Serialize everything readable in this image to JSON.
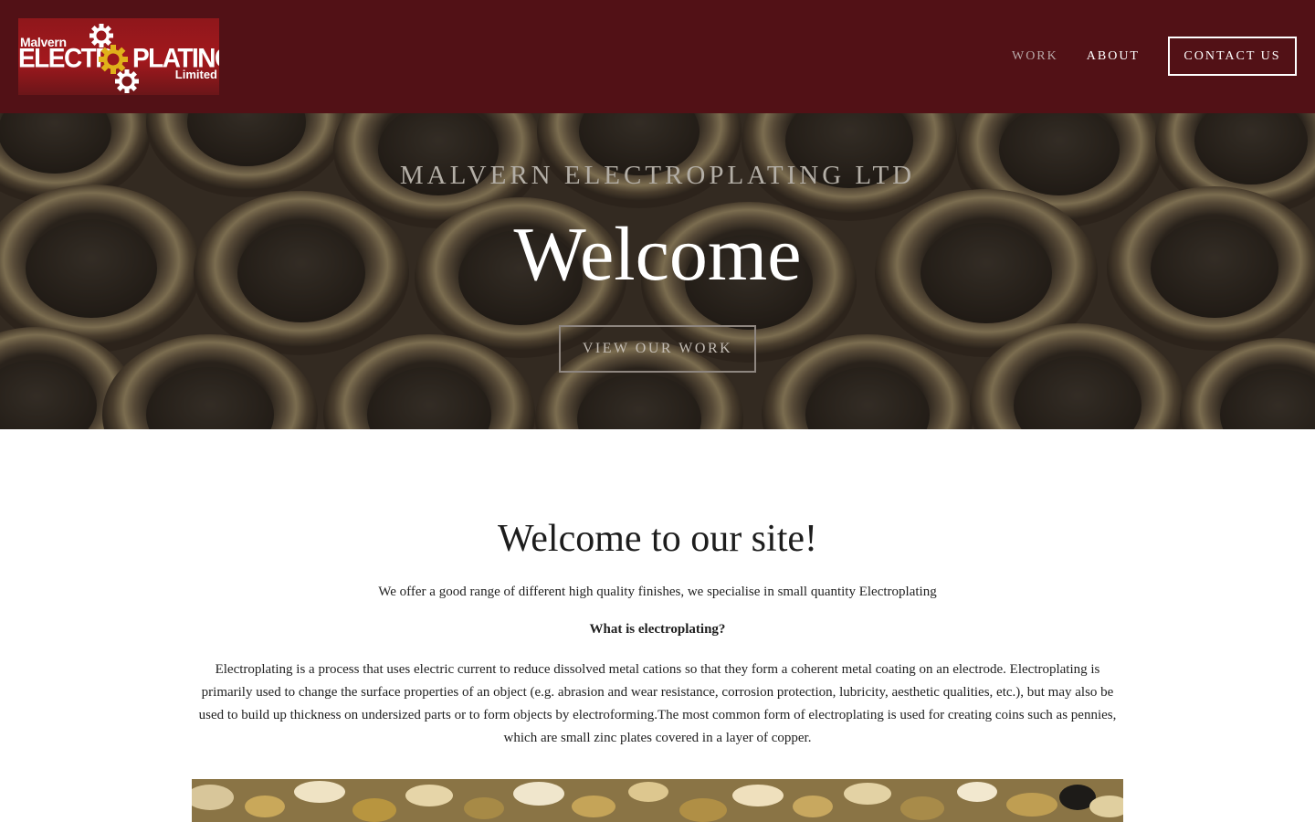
{
  "brand": {
    "logo_top": "Malvern",
    "logo_left": "ELECTR",
    "logo_right": "PLATING",
    "logo_bottom": "Limited",
    "colors": {
      "header_bg": "#521116",
      "logo_red": "#a3181d",
      "gear_gold": "#e0b11a"
    }
  },
  "nav": {
    "work": "WORK",
    "about": "ABOUT",
    "contact": "CONTACT US"
  },
  "hero": {
    "subtitle": "MALVERN ELECTROPLATING LTD",
    "title": "Welcome",
    "cta": "VIEW OUR WORK"
  },
  "content": {
    "title": "Welcome to our site!",
    "intro": "We offer a good range of different high quality finishes, we specialise in small quantity Electroplating",
    "question": "What is electroplating?",
    "body": "Electroplating is a process that uses electric current to reduce dissolved metal cations so that they form a coherent metal coating on an electrode. Electroplating is primarily used to change the surface properties of an object (e.g. abrasion and wear resistance, corrosion protection, lubricity, aesthetic qualities, etc.), but may also be used to build up thickness on undersized parts or to form objects by electroforming.The most common form of electroplating is used for creating coins such as pennies, which are small zinc plates covered in a layer of copper."
  }
}
